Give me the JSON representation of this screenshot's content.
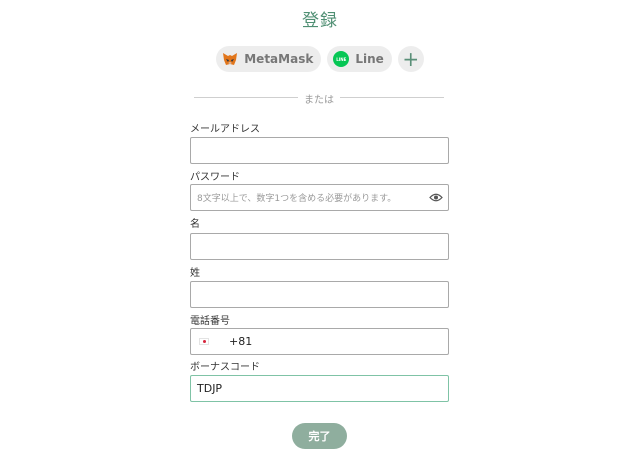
{
  "page": {
    "title": "登録"
  },
  "social": {
    "metamask_label": "MetaMask",
    "line_label": "Line",
    "line_icon_text": "LINE",
    "more_label": "+"
  },
  "divider": {
    "text": "または"
  },
  "form": {
    "email": {
      "label": "メールアドレス",
      "value": ""
    },
    "password": {
      "label": "パスワード",
      "placeholder": "8文字以上で、数字1つを含める必要があります。"
    },
    "first_name": {
      "label": "名",
      "value": ""
    },
    "last_name": {
      "label": "姓",
      "value": ""
    },
    "phone": {
      "label": "電話番号",
      "country_code": "+81"
    },
    "bonus_code": {
      "label": "ボーナスコード",
      "value": "TDJP"
    }
  },
  "submit": {
    "label": "完了"
  },
  "colors": {
    "accent": "#4f8f73",
    "button": "#8fae9e",
    "active_border": "#7fc3a6",
    "line_green": "#06c755"
  },
  "icons": [
    "metamask-fox-icon",
    "line-icon",
    "plus-icon",
    "eye-icon",
    "japan-flag-icon"
  ]
}
